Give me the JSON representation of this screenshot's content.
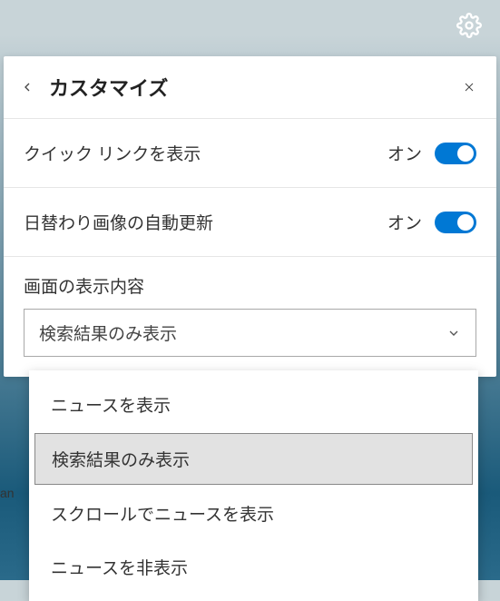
{
  "header": {
    "title": "カスタマイズ"
  },
  "settings": {
    "quicklinks": {
      "label": "クイック リンクを表示",
      "state": "オン"
    },
    "dailyimage": {
      "label": "日替わり画像の自動更新",
      "state": "オン"
    }
  },
  "displaySection": {
    "label": "画面の表示内容",
    "selected": "検索結果のみ表示",
    "options": [
      "ニュースを表示",
      "検索結果のみ表示",
      "スクロールでニュースを表示",
      "ニュースを非表示"
    ]
  },
  "background": {
    "partial_text": "an"
  }
}
